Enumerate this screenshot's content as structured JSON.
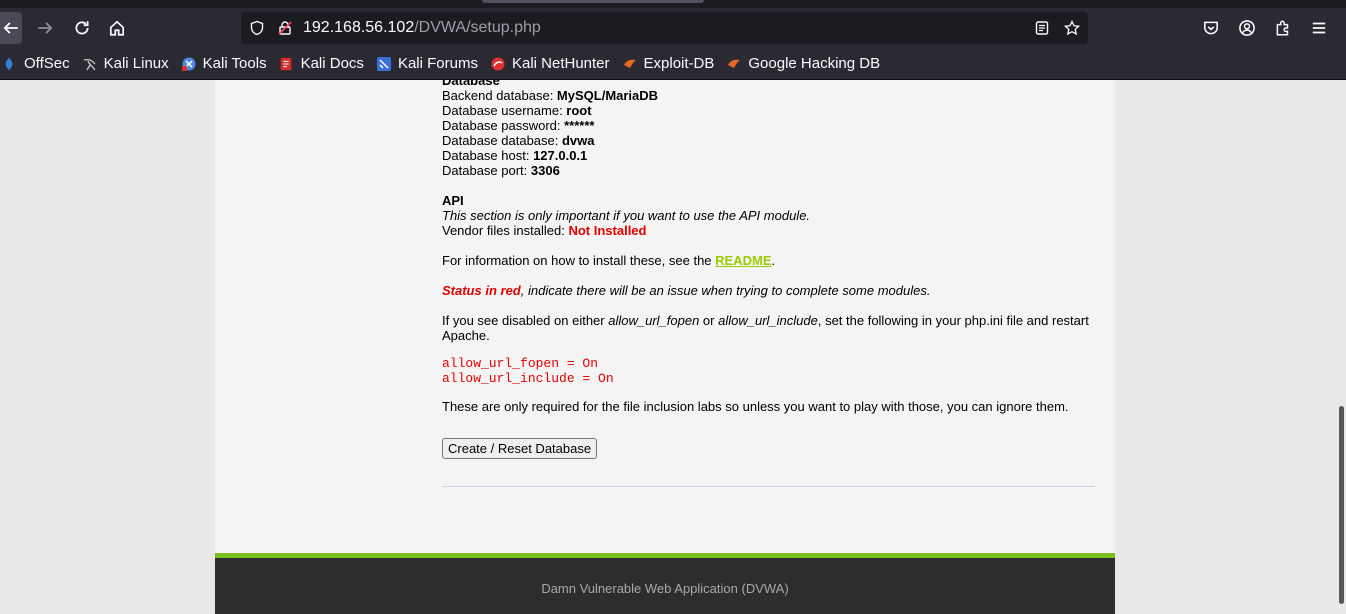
{
  "browser": {
    "url_host": "192.168.56.102",
    "url_path": "/DVWA/setup.php",
    "bookmarks": [
      {
        "label": "OffSec",
        "icon": "offsec-icon",
        "color": "#3a7bd5"
      },
      {
        "label": "Kali Linux",
        "icon": "kali-dragon-icon",
        "color": "#cccccc"
      },
      {
        "label": "Kali Tools",
        "icon": "kali-tools-icon",
        "color": "#4b8be0"
      },
      {
        "label": "Kali Docs",
        "icon": "kali-docs-icon",
        "color": "#d92b2b"
      },
      {
        "label": "Kali Forums",
        "icon": "kali-forums-icon",
        "color": "#3a6fd8"
      },
      {
        "label": "Kali NetHunter",
        "icon": "nethunter-icon",
        "color": "#e03030"
      },
      {
        "label": "Exploit-DB",
        "icon": "exploit-db-icon",
        "color": "#e66a1f"
      },
      {
        "label": "Google Hacking DB",
        "icon": "ghdb-icon",
        "color": "#e66a1f"
      }
    ]
  },
  "db": {
    "heading": "Database",
    "backend_label": "Backend database: ",
    "backend_value": "MySQL/MariaDB",
    "username_label": "Database username: ",
    "username_value": "root",
    "password_label": "Database password: ",
    "password_value": "******",
    "database_label": "Database database: ",
    "database_value": "dvwa",
    "host_label": "Database host: ",
    "host_value": "127.0.0.1",
    "port_label": "Database port: ",
    "port_value": "3306"
  },
  "api": {
    "heading": "API",
    "note": "This section is only important if you want to use the API module.",
    "vendor_label": "Vendor files installed: ",
    "vendor_value": "Not Installed"
  },
  "info": {
    "install_prefix": "For information on how to install these, see the ",
    "readme_link": "README",
    "install_suffix": ".",
    "status_red": "Status in red",
    "status_rest": ", indicate there will be an issue when trying to complete some modules.",
    "disabled_p1": "If you see disabled on either ",
    "disabled_fopen": "allow_url_fopen",
    "disabled_or": " or ",
    "disabled_include": "allow_url_include",
    "disabled_p2": ", set the following in your php.ini file and restart Apache.",
    "code_line1": "allow_url_fopen = On",
    "code_line2": "allow_url_include = On",
    "only_required": "These are only required for the file inclusion labs so unless you want to play with those, you can ignore them."
  },
  "actions": {
    "create_reset": "Create / Reset Database"
  },
  "footer": {
    "text": "Damn Vulnerable Web Application (DVWA)"
  }
}
